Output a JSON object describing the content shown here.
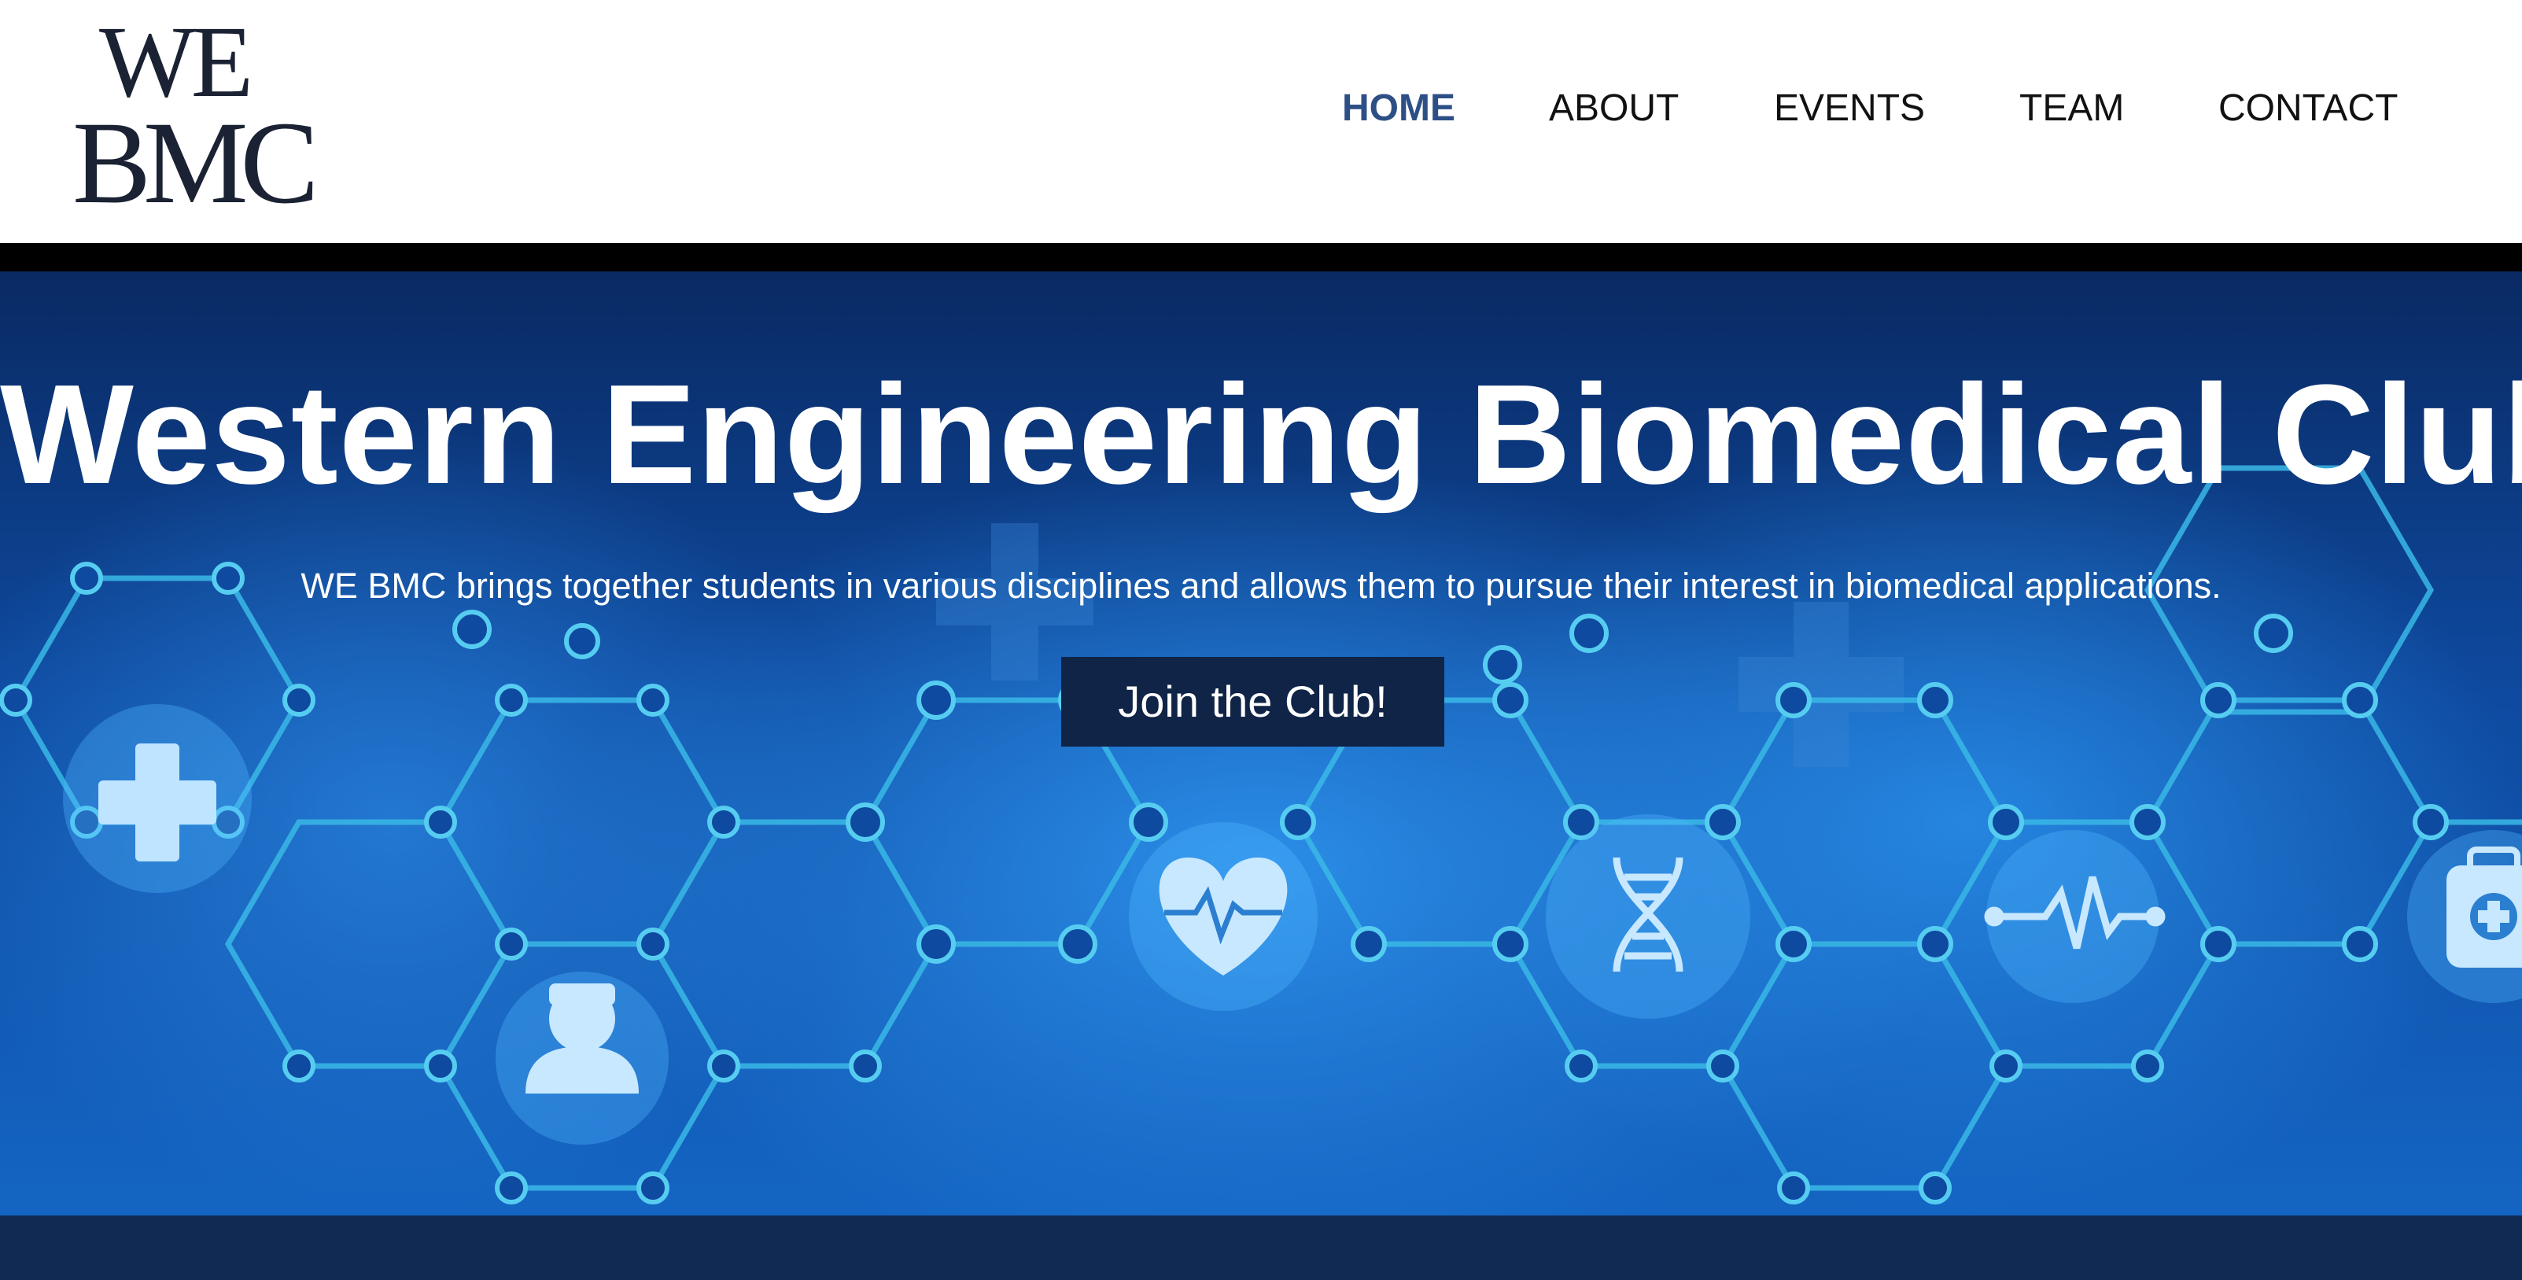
{
  "logo": {
    "line1": "WE",
    "line2": "BMC"
  },
  "nav": {
    "items": [
      {
        "label": "HOME",
        "active": true
      },
      {
        "label": "ABOUT",
        "active": false
      },
      {
        "label": "EVENTS",
        "active": false
      },
      {
        "label": "TEAM",
        "active": false
      },
      {
        "label": "CONTACT",
        "active": false
      }
    ]
  },
  "hero": {
    "title": "Western Engineering Biomedical Club",
    "subtitle": "WE BMC brings together students in various disciplines and allows them to pursue their interest in biomedical applications.",
    "cta_label": "Join the Club!",
    "icons": [
      "cross-icon",
      "doctor-icon",
      "heart-pulse-icon",
      "dna-icon",
      "heartbeat-line-icon",
      "medical-kit-icon"
    ]
  },
  "colors": {
    "nav_active": "#2d4f86",
    "nav_text": "#111111",
    "hero_dark": "#0a2a63",
    "hero_bright": "#2b8ee8",
    "cta_bg": "#0f2446",
    "bottom_band": "#102a53",
    "network_line": "#39b8e6"
  }
}
